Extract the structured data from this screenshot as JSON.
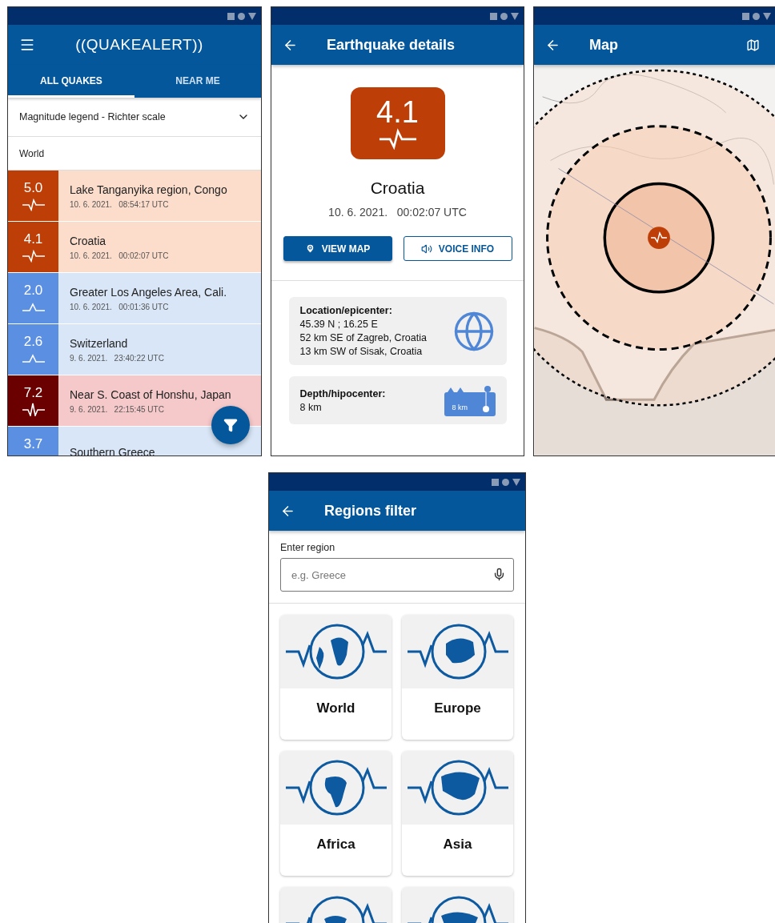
{
  "list_screen": {
    "logo": "((QUAKEALERT))",
    "tabs": [
      {
        "label": "ALL QUAKES",
        "selected": true
      },
      {
        "label": "NEAR ME",
        "selected": false
      }
    ],
    "legend": {
      "label": "Magnitude legend - Richter scale",
      "expanded": false
    },
    "region": "World",
    "quakes": [
      {
        "magnitude": "5.0",
        "kind": "moderate",
        "place": "Lake Tanganyika region, Congo",
        "time": "10. 6. 2021.   08:54:17 UTC"
      },
      {
        "magnitude": "4.1",
        "kind": "moderate",
        "place": "Croatia",
        "time": "10. 6. 2021.   00:02:07 UTC"
      },
      {
        "magnitude": "2.0",
        "kind": "light",
        "place": "Greater Los Angeles Area, Cali.",
        "time": "10. 6. 2021.   00:01:36 UTC"
      },
      {
        "magnitude": "2.6",
        "kind": "light",
        "place": "Switzerland",
        "time": "9. 6. 2021.   23:40:22 UTC"
      },
      {
        "magnitude": "7.2",
        "kind": "strong",
        "place": "Near S. Coast of Honshu, Japan",
        "time": "9. 6. 2021.   22:15:45 UTC"
      },
      {
        "magnitude": "3.7",
        "kind": "light",
        "place": "Southern Greece"
      }
    ]
  },
  "details_screen": {
    "title": "Earthquake details",
    "magnitude": "4.1",
    "kind": "moderate",
    "place": "Croatia",
    "time": "10. 6. 2021.   00:02:07 UTC",
    "buttons": [
      {
        "label": "VIEW MAP",
        "kind": "primary"
      },
      {
        "label": "VOICE INFO",
        "kind": "outline"
      }
    ],
    "location": {
      "label": "Location/epicenter:",
      "lines": [
        "45.39 N ; 16.25 E",
        "52 km SE of Zagreb, Croatia",
        "13 km SW of Sisak, Croatia"
      ]
    },
    "depth": {
      "label": "Depth/hipocenter:",
      "value": "8 km",
      "badge": "8 km"
    }
  },
  "map_screen": {
    "title": "Map"
  },
  "regions_screen": {
    "title": "Regions filter",
    "search": {
      "label": "Enter region",
      "placeholder": "e.g. Greece"
    },
    "regions": [
      {
        "name": "World",
        "kind": "world"
      },
      {
        "name": "Europe",
        "kind": "europe"
      },
      {
        "name": "Africa",
        "kind": "africa"
      },
      {
        "name": "Asia",
        "kind": "asia"
      },
      {
        "kind": "oceania"
      },
      {
        "kind": "americas"
      }
    ]
  }
}
